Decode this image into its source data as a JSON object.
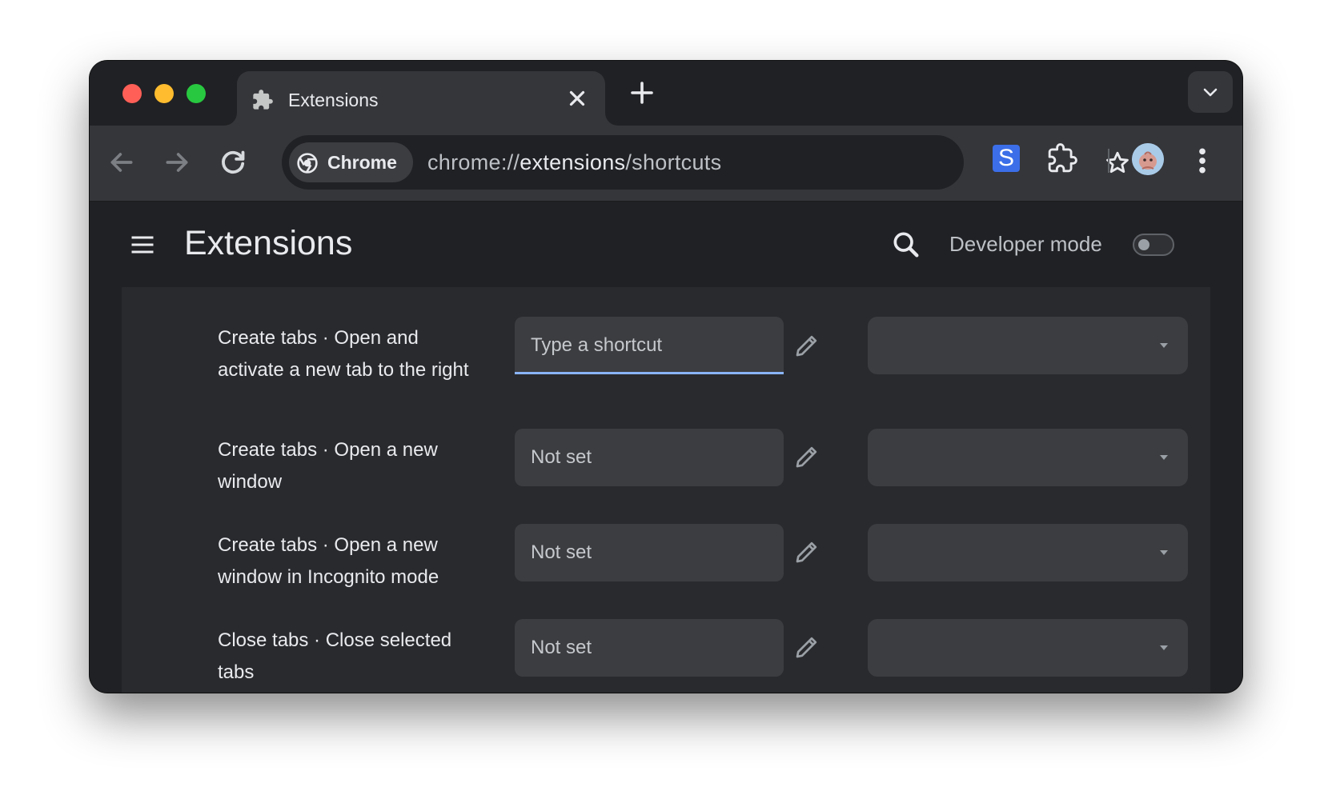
{
  "browser": {
    "tab": {
      "title": "Extensions"
    },
    "omnibox": {
      "chip_label": "Chrome",
      "url_scheme": "chrome://",
      "url_host": "extensions",
      "url_path": "/shortcuts"
    },
    "extension_badge": "S",
    "icons": {
      "tab": "puzzle-icon",
      "close": "close-icon",
      "new_tab": "plus-icon",
      "tab_search": "chevron-down-icon",
      "back": "back-arrow-icon",
      "forward": "forward-arrow-icon",
      "reload": "reload-icon",
      "bookmark": "star-icon",
      "extensions": "puzzle-icon",
      "menu": "kebab-icon"
    }
  },
  "page": {
    "title": "Extensions",
    "developer_mode_label": "Developer mode",
    "developer_mode_on": false
  },
  "shortcuts": [
    {
      "label": "Create tabs · Open and activate a new tab to the right",
      "field_text": "Type a shortcut",
      "active": true,
      "scope": ""
    },
    {
      "label": "Create tabs · Open a new window",
      "field_text": "Not set",
      "active": false,
      "scope": ""
    },
    {
      "label": "Create tabs · Open a new window in Incognito mode",
      "field_text": "Not set",
      "active": false,
      "scope": ""
    },
    {
      "label": "Close tabs · Close selected tabs",
      "field_text": "Not set",
      "active": false,
      "scope": ""
    }
  ],
  "colors": {
    "accent": "#8ab4f8",
    "extension_badge": "#3b6ee8"
  }
}
